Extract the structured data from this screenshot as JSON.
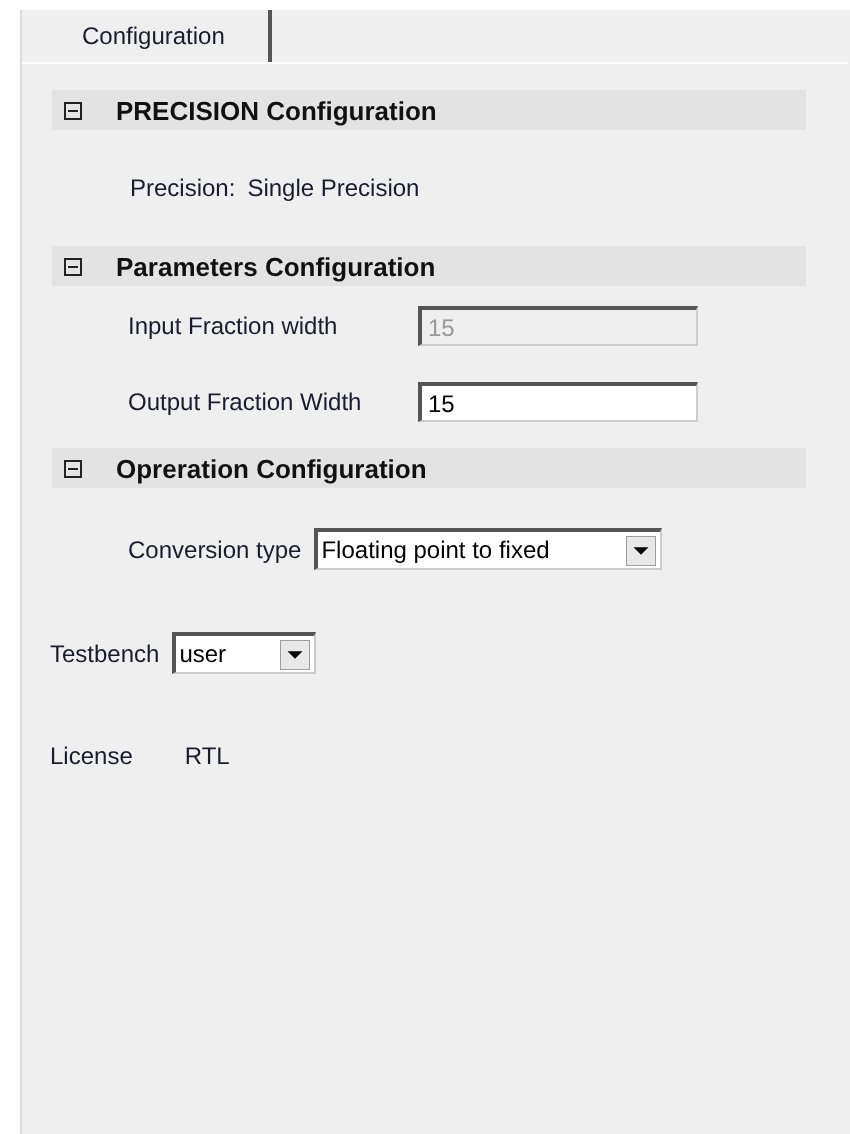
{
  "tabs": [
    {
      "label": "Configuration",
      "selected": true
    }
  ],
  "sections": [
    {
      "title": "PRECISION Configuration",
      "expanded": true,
      "rows": [
        {
          "kind": "text",
          "label": "Precision:",
          "value": "Single Precision"
        }
      ]
    },
    {
      "title": "Parameters Configuration",
      "expanded": true,
      "rows": [
        {
          "kind": "field",
          "label": "Input Fraction width",
          "value": "15",
          "disabled": true
        },
        {
          "kind": "field",
          "label": "Output Fraction Width",
          "value": "15",
          "disabled": false
        }
      ]
    },
    {
      "title": "Opreration Configuration",
      "expanded": true,
      "rows": [
        {
          "kind": "dropdown",
          "label": "Conversion type",
          "value": "Floating point to fixed"
        }
      ]
    }
  ],
  "testbench": {
    "label": "Testbench",
    "value": "user"
  },
  "license": {
    "label": "License",
    "value": "RTL"
  }
}
